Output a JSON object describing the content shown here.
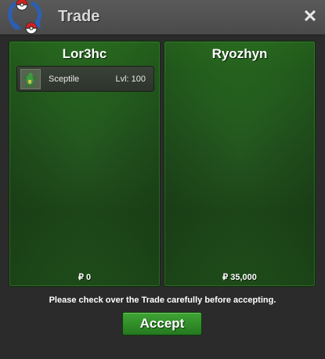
{
  "window": {
    "title": "Trade"
  },
  "icons": {
    "close": "close-icon",
    "logo": "pokeball-logo-icon",
    "pokemon": "sceptile-sprite-icon"
  },
  "left_panel": {
    "name": "Lor3hc",
    "items": [
      {
        "name": "Sceptile",
        "level": "Lvl: 100"
      }
    ],
    "money": "₽ 0"
  },
  "right_panel": {
    "name": "Ryozhyn",
    "items": [],
    "money": "₽ 35,000"
  },
  "notice": "Please check over the Trade carefully before accepting.",
  "accept_label": "Accept",
  "colors": {
    "panel_green": "#2a6e22",
    "accept_green": "#3fa534",
    "title_bar": "#505050"
  }
}
